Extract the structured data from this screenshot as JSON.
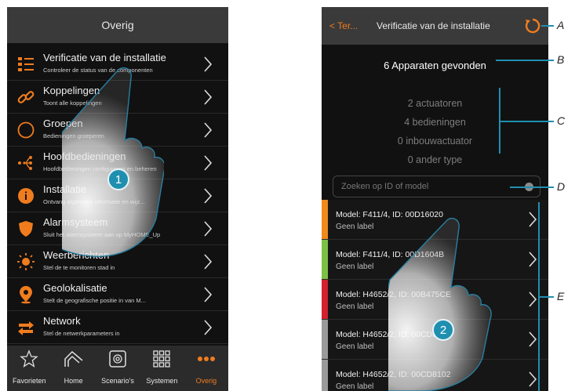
{
  "left_screen": {
    "title": "Overig",
    "items": [
      {
        "icon": "checklist-icon",
        "title": "Verificatie van de installatie",
        "subtitle": "Controleer de status van de componenten"
      },
      {
        "icon": "link-icon",
        "title": "Koppelingen",
        "subtitle": "Toont alle koppelingen"
      },
      {
        "icon": "circle-icon",
        "title": "Groepen",
        "subtitle": "Bedieningen groeperen"
      },
      {
        "icon": "main-control-icon",
        "title": "Hoofdbedieningen",
        "subtitle": "Hoofdbedieningen configureren en beheren"
      },
      {
        "icon": "info-icon",
        "title": "Installatie",
        "subtitle": "Ontvang algemene informatie en wijz..."
      },
      {
        "icon": "shield-icon",
        "title": "Alarmsysteem",
        "subtitle": "Sluit het alarmsysteem aan op MyHOME_Up"
      },
      {
        "icon": "sun-icon",
        "title": "Weerberichten",
        "subtitle": "Stel de te monitoren stad in"
      },
      {
        "icon": "location-pin-icon",
        "title": "Geolokalisatie",
        "subtitle": "Stelt de geografische positie in van M..."
      },
      {
        "icon": "network-icon",
        "title": "Network",
        "subtitle": "Stel de netwerkparameters in"
      }
    ],
    "nav": [
      {
        "icon": "star-icon",
        "label": "Favorieten",
        "active": false
      },
      {
        "icon": "home-icon",
        "label": "Home",
        "active": false
      },
      {
        "icon": "scenario-icon",
        "label": "Scenario's",
        "active": false
      },
      {
        "icon": "grid-icon",
        "label": "Systemen",
        "active": false
      },
      {
        "icon": "more-dots-icon",
        "label": "Overig",
        "active": true
      }
    ],
    "step_badge": "1"
  },
  "right_screen": {
    "back_label": "Ter...",
    "title": "Verificatie van de installatie",
    "devices_found": "6 Apparaten gevonden",
    "stats": [
      "2 actuatoren",
      "4 bedieningen",
      "0 inbouwactuator",
      "0 ander type"
    ],
    "search_placeholder": "Zoeken op ID of model",
    "devices": [
      {
        "model": "Model: F411/4, ID: 00D16020",
        "label": "Geen label",
        "color": "#f08a1e"
      },
      {
        "model": "Model: F411/4, ID: 00D1604B",
        "label": "Geen label",
        "color": "#7cc143"
      },
      {
        "model": "Model: H4652/2, ID: 00B475CE",
        "label": "Geen label",
        "color": "#d4202f"
      },
      {
        "model": "Model: H4652/2, ID: 00CD81AD",
        "label": "Geen label",
        "color": "#9a9a9a"
      },
      {
        "model": "Model: H4652/2, ID: 00CD8102",
        "label": "Geen label",
        "color": "#9a9a9a"
      }
    ],
    "step_badge": "2"
  },
  "callouts": [
    "A",
    "B",
    "C",
    "D",
    "E"
  ],
  "colors": {
    "accent": "#f07c1e",
    "callout": "#1f8fb0",
    "background": "#111111"
  }
}
